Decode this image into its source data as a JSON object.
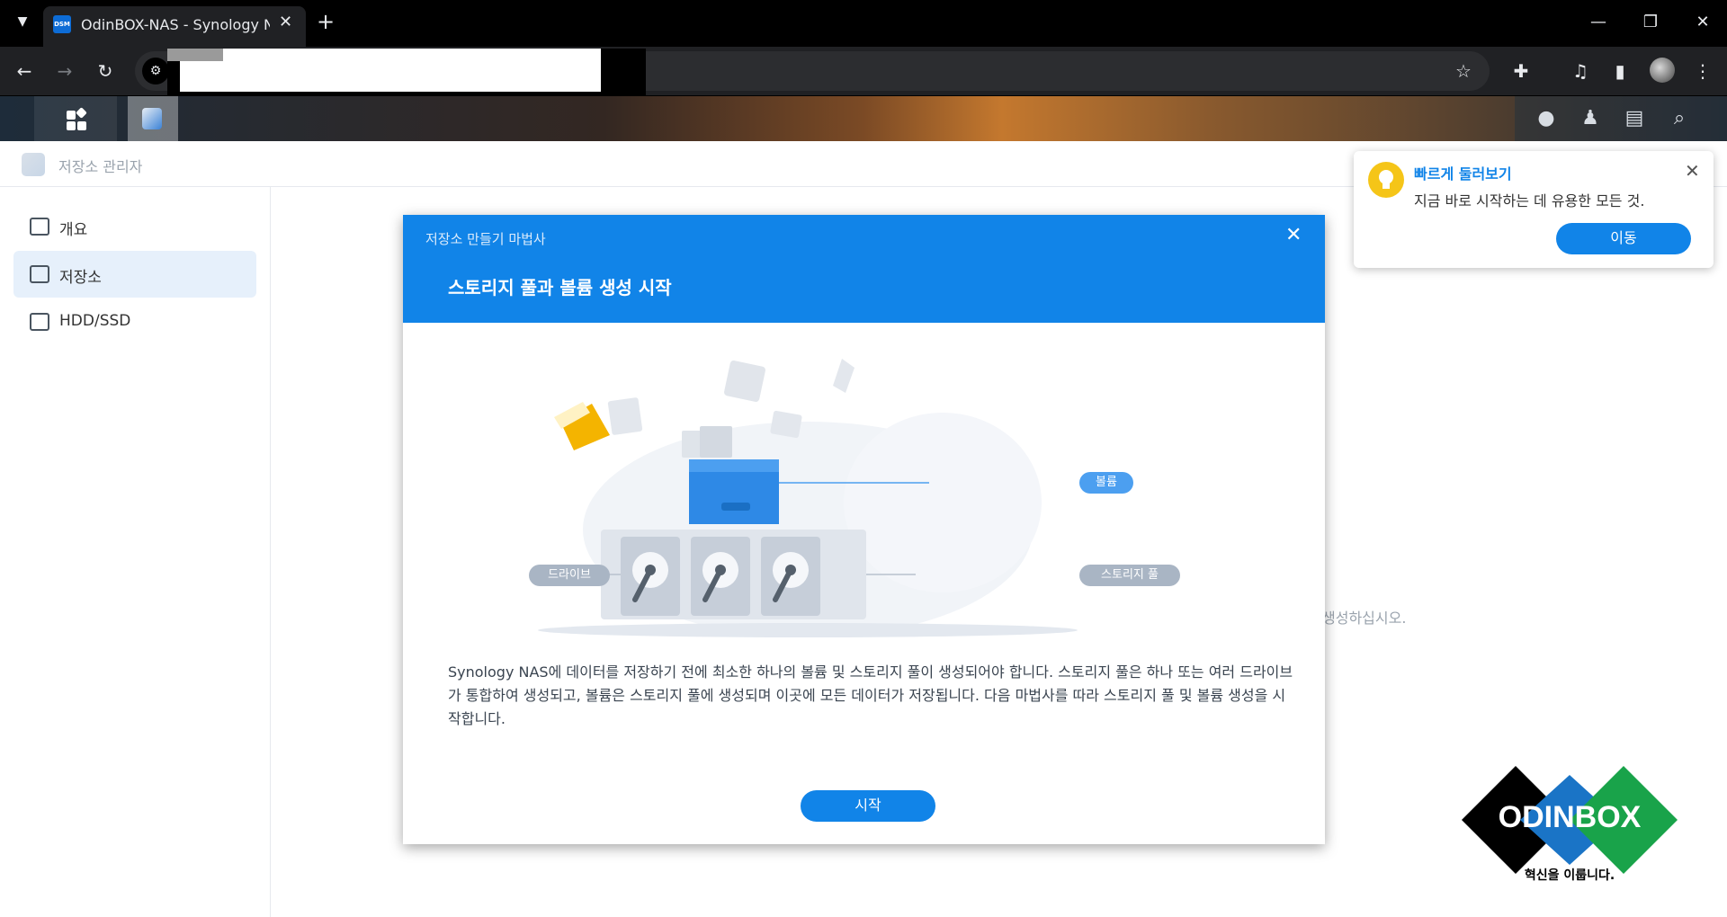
{
  "browser": {
    "tab_title": "OdinBOX-NAS - Synology NAS",
    "favicon_text": "DSM"
  },
  "app": {
    "title": "저장소 관리자"
  },
  "sidebar": {
    "items": [
      {
        "label": "개요"
      },
      {
        "label": "저장소"
      },
      {
        "label": "HDD/SSD"
      }
    ]
  },
  "background_hint": "생성하십시오.",
  "wizard": {
    "caption": "저장소 만들기 마법사",
    "heading": "스토리지 풀과 볼륨 생성 시작",
    "labels": {
      "volume": "볼륨",
      "drive": "드라이브",
      "storage_pool": "스토리지 풀"
    },
    "description": "Synology NAS에 데이터를 저장하기 전에 최소한 하나의 볼륨 및 스토리지 풀이 생성되어야 합니다. 스토리지 풀은 하나 또는 여러 드라이브가 통합하여 생성되고, 볼륨은 스토리지 풀에 생성되며 이곳에 모든 데이터가 저장됩니다. 다음 마법사를 따라 스토리지 풀 및 볼륨 생성을 시작합니다.",
    "start_label": "시작"
  },
  "quick_tour": {
    "title": "빠르게 둘러보기",
    "text": "지금 바로 시작하는 데 유용한 모든 것.",
    "go_label": "이동"
  },
  "logo": {
    "name": "ODINBOX",
    "tagline": "혁신을 이룹니다."
  },
  "colors": {
    "accent": "#1184e8",
    "sidebar_active": "#e6f0fb"
  }
}
